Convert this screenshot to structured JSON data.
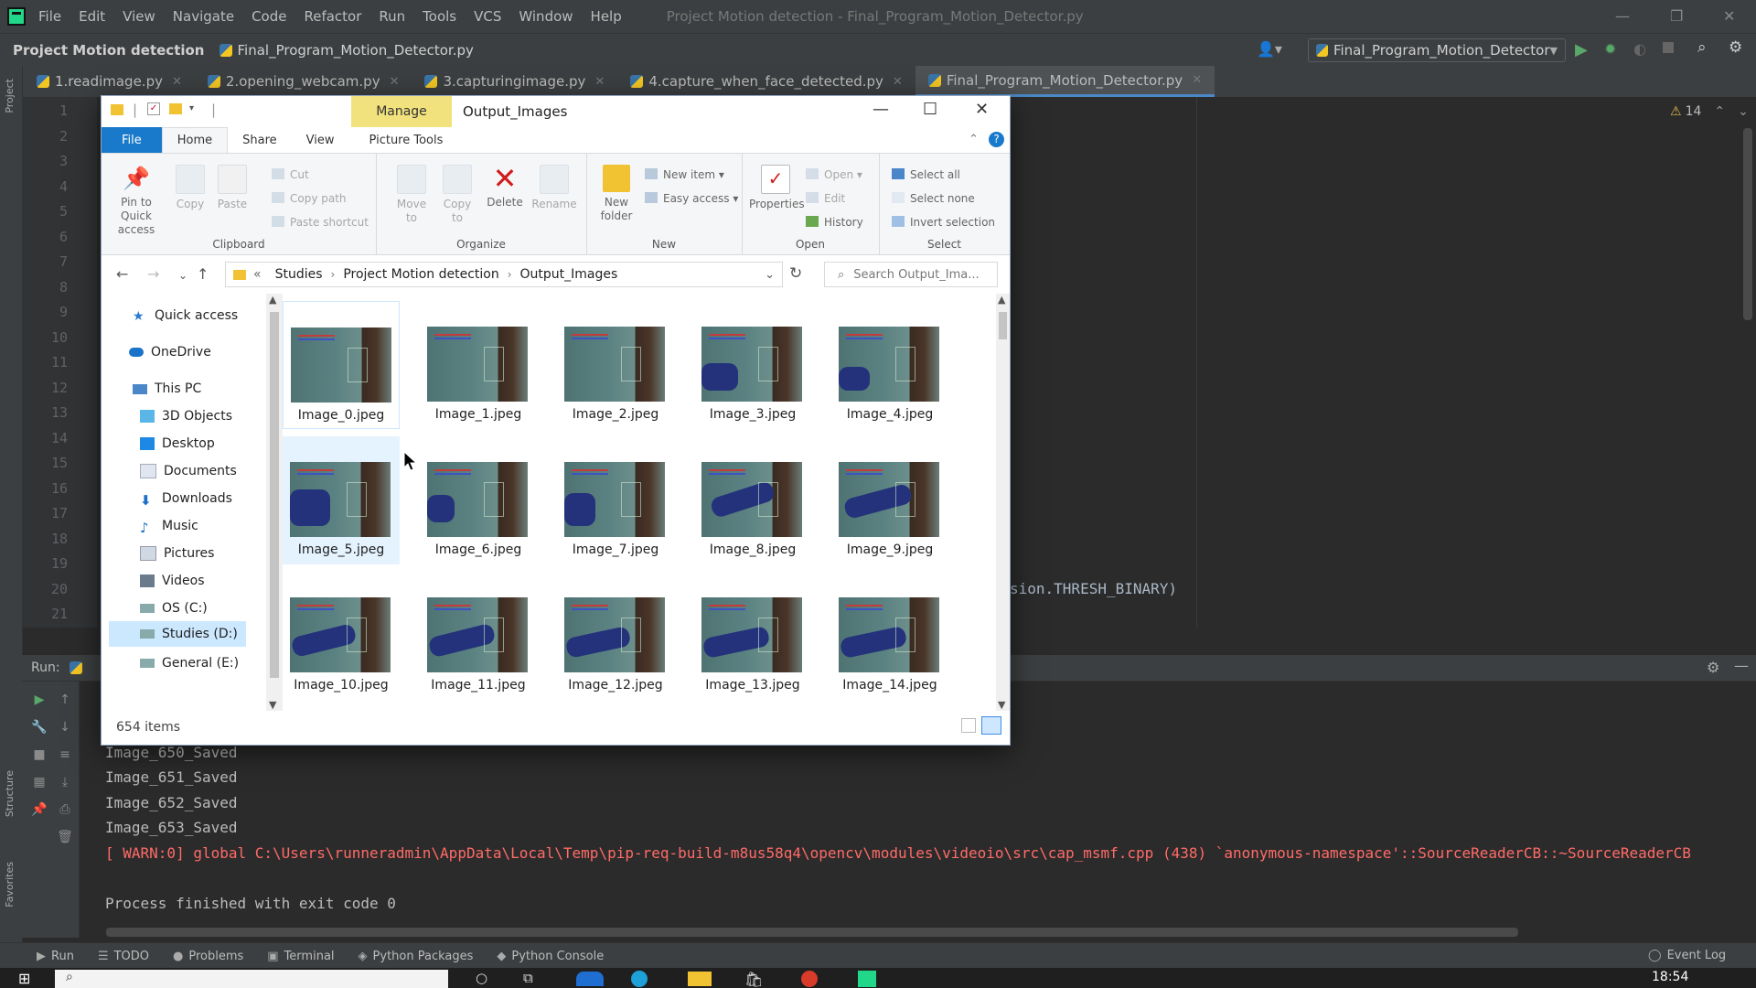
{
  "ide": {
    "menu": [
      "File",
      "Edit",
      "View",
      "Navigate",
      "Code",
      "Refactor",
      "Run",
      "Tools",
      "VCS",
      "Window",
      "Help"
    ],
    "window_title": "Project Motion detection - Final_Program_Motion_Detector.py",
    "breadcrumb": {
      "project": "Project Motion detection",
      "file": "Final_Program_Motion_Detector.py"
    },
    "run_config": "Final_Program_Motion_Detector",
    "tabs": [
      {
        "label": "1.readimage.py",
        "active": false
      },
      {
        "label": "2.opening_webcam.py",
        "active": false
      },
      {
        "label": "3.capturingimage.py",
        "active": false
      },
      {
        "label": "4.capture_when_face_detected.py",
        "active": false
      },
      {
        "label": "Final_Program_Motion_Detector.py",
        "active": true
      }
    ],
    "line_numbers": [
      "1",
      "2",
      "3",
      "4",
      "5",
      "6",
      "7",
      "8",
      "9",
      "10",
      "11",
      "12",
      "13",
      "14",
      "15",
      "16",
      "17",
      "18",
      "19",
      "20",
      "21"
    ],
    "code_fragment": "sion.THRESH_BINARY)",
    "warnings_count": "14",
    "run_label": "Run:",
    "console_lines": [
      {
        "text": "Image_650_Saved",
        "type": "normal"
      },
      {
        "text": "Image_651_Saved",
        "type": "normal"
      },
      {
        "text": "Image_652_Saved",
        "type": "normal"
      },
      {
        "text": "Image_653_Saved",
        "type": "normal"
      },
      {
        "text": "[ WARN:0] global C:\\Users\\runneradmin\\AppData\\Local\\Temp\\pip-req-build-m8us58q4\\opencv\\modules\\videoio\\src\\cap_msmf.cpp (438) `anonymous-namespace'::SourceReaderCB::~SourceReaderCB",
        "type": "warn"
      },
      {
        "text": "",
        "type": "normal"
      },
      {
        "text": "Process finished with exit code 0",
        "type": "normal"
      }
    ],
    "bottom_tabs": [
      "Run",
      "TODO",
      "Problems",
      "Terminal",
      "Python Packages",
      "Python Console"
    ],
    "event_log": "Event Log",
    "side_labels": {
      "project": "Project",
      "structure": "Structure",
      "favorites": "Favorites"
    }
  },
  "taskbar": {
    "time": "18:54"
  },
  "explorer": {
    "title": "Output_Images",
    "context_tab": "Manage",
    "ribbon_tabs": [
      "File",
      "Home",
      "Share",
      "View",
      "Picture Tools"
    ],
    "ribbon": {
      "clipboard": {
        "label": "Clipboard",
        "pin": "Pin to Quick access",
        "copy": "Copy",
        "paste": "Paste",
        "cut": "Cut",
        "copy_path": "Copy path",
        "paste_shortcut": "Paste shortcut"
      },
      "organize": {
        "label": "Organize",
        "move_to": "Move to",
        "copy_to": "Copy to",
        "delete": "Delete",
        "rename": "Rename"
      },
      "new": {
        "label": "New",
        "new_folder": "New folder",
        "new_item": "New item",
        "easy_access": "Easy access"
      },
      "open": {
        "label": "Open",
        "properties": "Properties",
        "open": "Open",
        "edit": "Edit",
        "history": "History"
      },
      "select": {
        "label": "Select",
        "select_all": "Select all",
        "select_none": "Select none",
        "invert": "Invert selection"
      }
    },
    "address": {
      "overflow": "«",
      "path": [
        "Studies",
        "Project Motion detection",
        "Output_Images"
      ]
    },
    "search_placeholder": "Search Output_Ima...",
    "nav": [
      {
        "label": "Quick access",
        "icon": "star-icon",
        "indent": 0
      },
      {
        "label": "OneDrive",
        "icon": "cloud-icon",
        "indent": 0
      },
      {
        "label": "This PC",
        "icon": "computer-icon",
        "indent": 0
      },
      {
        "label": "3D Objects",
        "icon": "cube-icon",
        "indent": 1
      },
      {
        "label": "Desktop",
        "icon": "desktop-icon",
        "indent": 1
      },
      {
        "label": "Documents",
        "icon": "document-icon",
        "indent": 1
      },
      {
        "label": "Downloads",
        "icon": "download-icon",
        "indent": 1
      },
      {
        "label": "Music",
        "icon": "music-icon",
        "indent": 1
      },
      {
        "label": "Pictures",
        "icon": "pictures-icon",
        "indent": 1
      },
      {
        "label": "Videos",
        "icon": "video-icon",
        "indent": 1
      },
      {
        "label": "OS (C:)",
        "icon": "drive-icon",
        "indent": 1
      },
      {
        "label": "Studies (D:)",
        "icon": "drive-icon",
        "indent": 1,
        "selected": true
      },
      {
        "label": "General (E:)",
        "icon": "drive-icon",
        "indent": 1
      }
    ],
    "files": [
      "Image_0.jpeg",
      "Image_1.jpeg",
      "Image_2.jpeg",
      "Image_3.jpeg",
      "Image_4.jpeg",
      "Image_5.jpeg",
      "Image_6.jpeg",
      "Image_7.jpeg",
      "Image_8.jpeg",
      "Image_9.jpeg",
      "Image_10.jpeg",
      "Image_11.jpeg",
      "Image_12.jpeg",
      "Image_13.jpeg",
      "Image_14.jpeg"
    ],
    "status": "654 items"
  }
}
